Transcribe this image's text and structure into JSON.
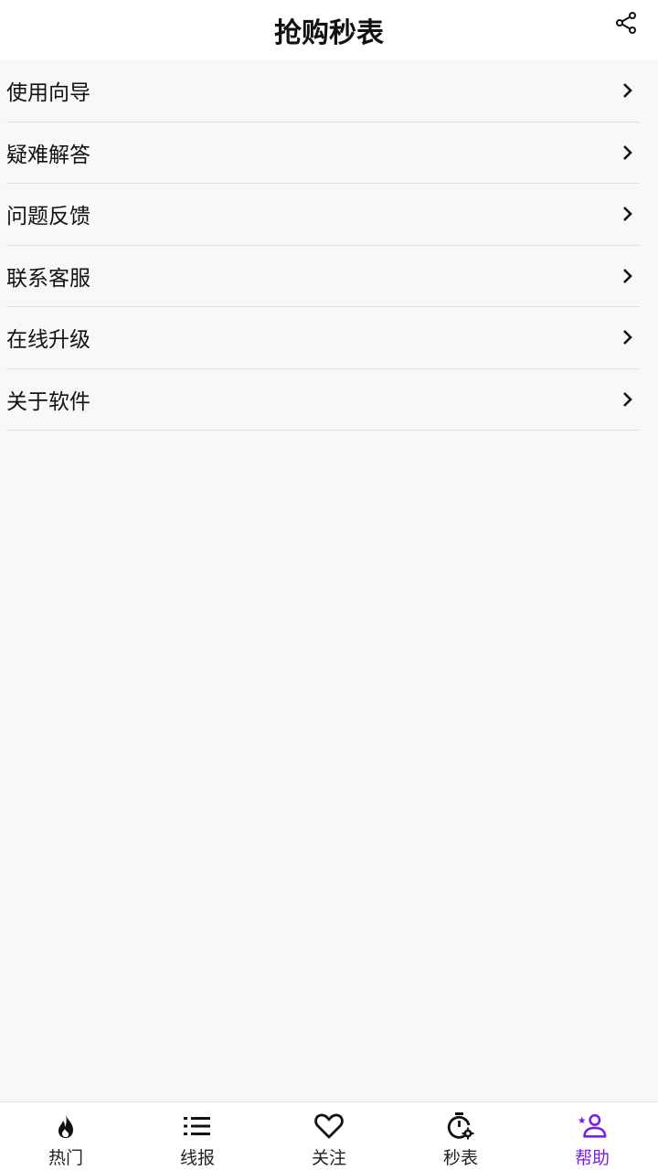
{
  "header": {
    "title": "抢购秒表",
    "share_icon": "share-icon"
  },
  "menu": {
    "items": [
      {
        "label": "使用向导"
      },
      {
        "label": "疑难解答"
      },
      {
        "label": "问题反馈"
      },
      {
        "label": "联系客服"
      },
      {
        "label": "在线升级"
      },
      {
        "label": "关于软件"
      }
    ]
  },
  "tabbar": {
    "active_color": "#7a1fe8",
    "tabs": [
      {
        "label": "热门",
        "icon": "flame-icon"
      },
      {
        "label": "线报",
        "icon": "list-icon"
      },
      {
        "label": "关注",
        "icon": "heart-icon"
      },
      {
        "label": "秒表",
        "icon": "stopwatch-icon"
      },
      {
        "label": "帮助",
        "icon": "help-person-icon",
        "active": true
      }
    ]
  }
}
